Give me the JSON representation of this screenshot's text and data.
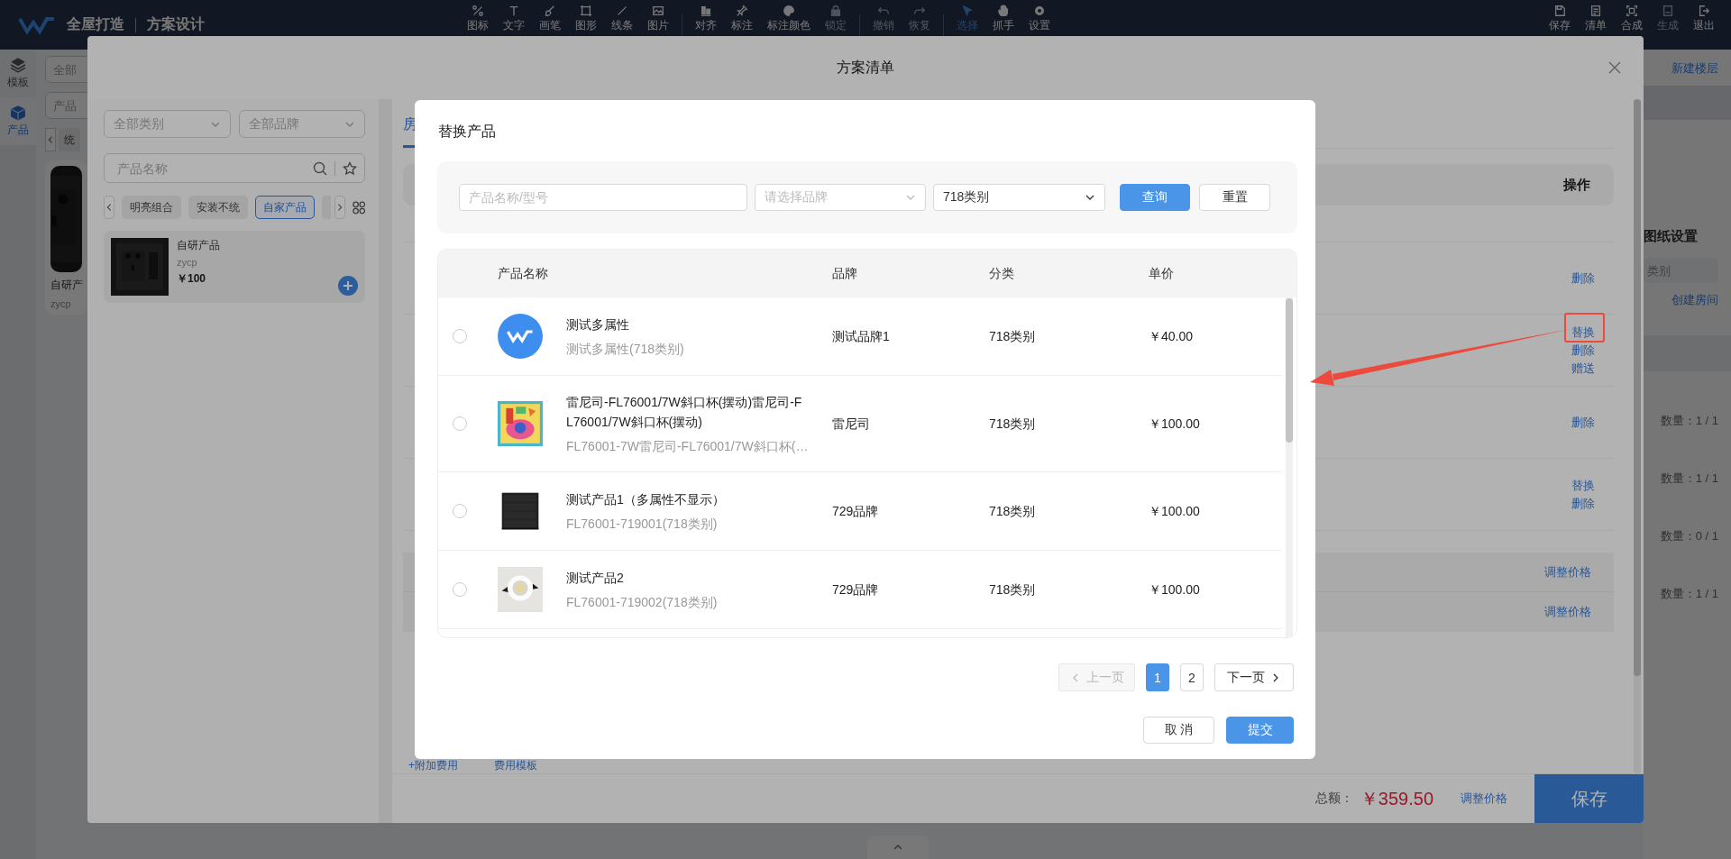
{
  "top_bar": {
    "app_name": "全屋打造",
    "page_title": "方案设计",
    "tools": [
      {
        "label": "图标",
        "selected": false,
        "disabled": false
      },
      {
        "label": "文字",
        "selected": false,
        "disabled": false
      },
      {
        "label": "画笔",
        "selected": false,
        "disabled": false
      },
      {
        "label": "图形",
        "selected": false,
        "disabled": false
      },
      {
        "label": "线条",
        "selected": false,
        "disabled": false
      },
      {
        "label": "图片",
        "selected": false,
        "disabled": false
      },
      {
        "label": "对齐",
        "selected": false,
        "disabled": false
      },
      {
        "label": "标注",
        "selected": false,
        "disabled": false
      },
      {
        "label": "标注颜色",
        "selected": false,
        "disabled": false
      },
      {
        "label": "锁定",
        "selected": false,
        "disabled": true
      },
      {
        "label": "撤销",
        "selected": false,
        "disabled": true
      },
      {
        "label": "恢复",
        "selected": false,
        "disabled": true
      },
      {
        "label": "选择",
        "selected": true,
        "disabled": false
      },
      {
        "label": "抓手",
        "selected": false,
        "disabled": false
      },
      {
        "label": "设置",
        "selected": false,
        "disabled": false
      }
    ],
    "actions": [
      {
        "label": "保存",
        "disabled": false
      },
      {
        "label": "清单",
        "disabled": false
      },
      {
        "label": "合成",
        "disabled": false
      },
      {
        "label": "生成",
        "disabled": true
      },
      {
        "label": "退出",
        "disabled": false
      }
    ]
  },
  "side_rail": [
    {
      "label": "模板",
      "selected": false
    },
    {
      "label": "产品",
      "selected": true
    }
  ],
  "background_panel": {
    "filter_1": "全部",
    "filter_2": "产品",
    "chip": "统",
    "card_name": "自研产",
    "card_brand": "zycp"
  },
  "right_panel": {
    "new_floor": "新建楼层",
    "drawing_settings": "图纸设置",
    "category": "类别",
    "create_room": "创建房间",
    "quantities": [
      "数量：1 / 1",
      "数量：1 / 1",
      "数量：0 / 1",
      "数量：1 / 1"
    ]
  },
  "plan_dialog": {
    "title": "方案清单",
    "catalog": {
      "category_select": "全部类别",
      "brand_select": "全部品牌",
      "search_placeholder": "产品名称",
      "chips": [
        {
          "label": "明亮组合",
          "selected": false
        },
        {
          "label": "安装不统",
          "selected": false
        },
        {
          "label": "自家产品",
          "selected": true
        }
      ],
      "products": [
        {
          "name": "自研产品",
          "brand": "zycp",
          "price": "￥100"
        }
      ]
    },
    "tab": "房",
    "header_action": "操作",
    "rows": [
      {
        "actions": [
          "删除"
        ]
      },
      {
        "actions": [
          "替换",
          "删除",
          "赠送"
        ]
      },
      {
        "actions": [
          "删除"
        ]
      },
      {
        "actions": [
          "替换",
          "删除"
        ]
      }
    ],
    "adjust_links": [
      "调整价格",
      "调整价格"
    ],
    "footer_links": [
      "+附加费用",
      "费用模板"
    ],
    "total_label": "总额：",
    "total": "￥359.50",
    "adjust_price": "调整价格",
    "save": "保存"
  },
  "replace_dialog": {
    "title": "替换产品",
    "search_placeholder": "产品名称/型号",
    "brand_placeholder": "请选择品牌",
    "category_value": "718类别",
    "query": "查询",
    "reset": "重置",
    "columns": [
      "产品名称",
      "品牌",
      "分类",
      "单价"
    ],
    "rows": [
      {
        "selected": false,
        "image": {
          "kind": "logo"
        },
        "name": "测试多属性",
        "subtitle": "测试多属性(718类别)",
        "brand": "测试品牌1",
        "category": "718类别",
        "price": "￥40.00"
      },
      {
        "selected": false,
        "name": "雷尼司-FL76001/7W斜口杯(摆动)雷尼司-FL76001/7W斜口杯(摆动)",
        "subtitle": "FL76001-7W雷尼司-FL76001/7W斜口杯(…",
        "brand": "雷尼司",
        "category": "718类别",
        "price": "￥100.00"
      },
      {
        "selected": false,
        "name": "测试产品1（多属性不显示）",
        "subtitle": "FL76001-719001(718类别)",
        "brand": "729品牌",
        "category": "718类别",
        "price": "￥100.00"
      },
      {
        "selected": false,
        "name": "测试产品2",
        "subtitle": "FL76001-719002(718类别)",
        "brand": "729品牌",
        "category": "718类别",
        "price": "￥100.00"
      }
    ],
    "pagination": {
      "prev": {
        "label": "上一页",
        "disabled": true
      },
      "pages": [
        {
          "label": "1",
          "selected": true
        },
        {
          "label": "2",
          "selected": false
        }
      ],
      "next": {
        "label": "下一页",
        "disabled": false
      }
    },
    "cancel": "取 消",
    "submit": "提交"
  }
}
